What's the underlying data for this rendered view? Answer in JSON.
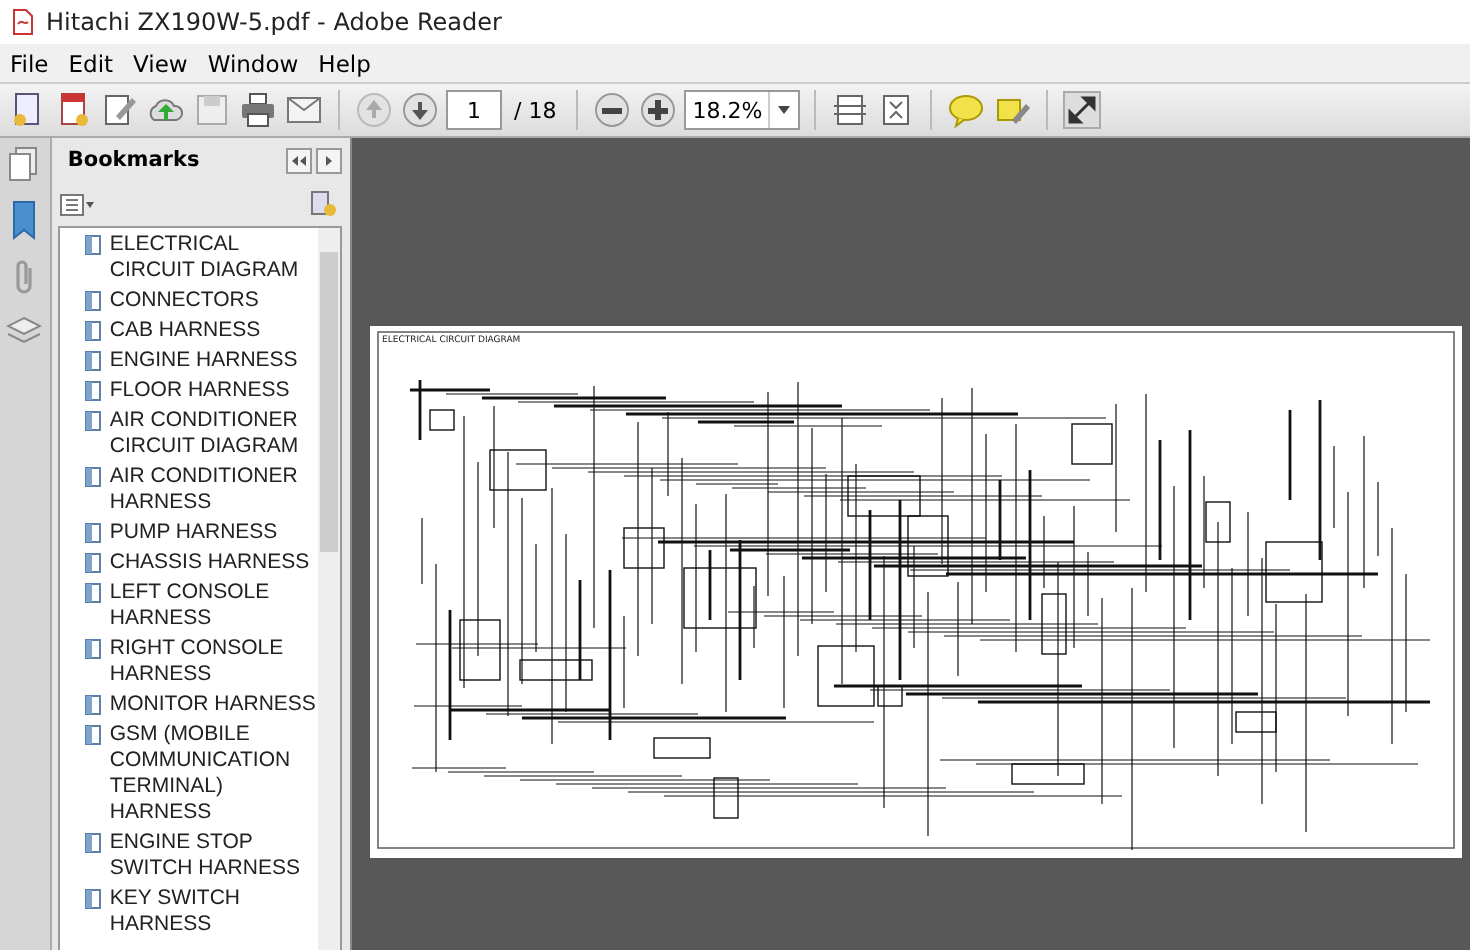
{
  "window": {
    "title": "Hitachi ZX190W-5.pdf - Adobe Reader"
  },
  "menu": [
    "File",
    "Edit",
    "View",
    "Window",
    "Help"
  ],
  "toolbar": {
    "page_number": "1",
    "page_count": "/ 18",
    "zoom": "18.2%"
  },
  "bookmarks": {
    "title": "Bookmarks",
    "items": [
      "ELECTRICAL CIRCUIT DIAGRAM",
      "CONNECTORS",
      "CAB HARNESS",
      "ENGINE HARNESS",
      "FLOOR HARNESS",
      "AIR CONDITIONER CIRCUIT DIAGRAM",
      "AIR CONDITIONER HARNESS",
      "PUMP HARNESS",
      "CHASSIS HARNESS",
      "LEFT CONSOLE HARNESS",
      "RIGHT CONSOLE HARNESS",
      "MONITOR HARNESS",
      "GSM (MOBILE COMMUNICATION TERMINAL) HARNESS",
      "ENGINE STOP SWITCH HARNESS",
      "KEY SWITCH HARNESS"
    ]
  },
  "document": {
    "page_heading": "ELECTRICAL CIRCUIT DIAGRAM"
  }
}
